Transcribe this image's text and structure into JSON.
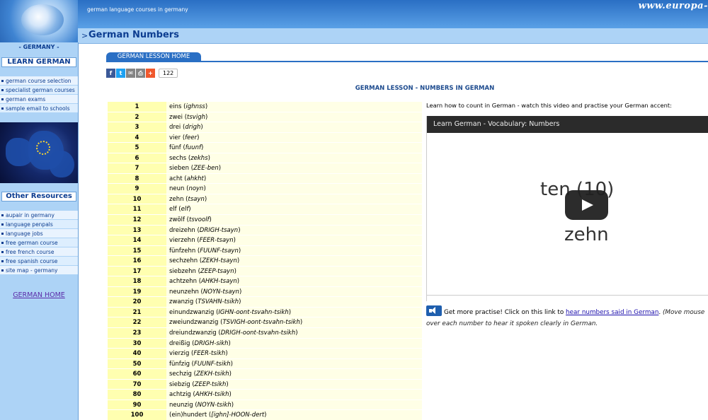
{
  "header": {
    "tagline": "german language courses in germany",
    "site_url": "www.europa-"
  },
  "title_bar": {
    "arrow": ">",
    "title": "German Numbers"
  },
  "sidebar": {
    "country": "- GERMANY -",
    "learn_heading": "LEARN GERMAN",
    "learn_items": [
      {
        "label": "german course selection"
      },
      {
        "label": "specialist german courses"
      },
      {
        "label": "german exams"
      },
      {
        "label": "sample email to schools"
      }
    ],
    "resources_heading": "Other Resources",
    "resource_items": [
      {
        "label": "aupair in germany"
      },
      {
        "label": "language penpals"
      },
      {
        "label": "language jobs"
      },
      {
        "label": "free german course"
      },
      {
        "label": "free french course"
      },
      {
        "label": "free spanish course"
      },
      {
        "label": "site map - germany"
      }
    ],
    "home_link": "GERMAN HOME"
  },
  "lesson_tab": "GERMAN LESSON HOME",
  "share": {
    "buttons": [
      {
        "icon": "facebook-icon",
        "glyph": "f",
        "color": "#3b5998"
      },
      {
        "icon": "twitter-icon",
        "glyph": "t",
        "color": "#1da1f2"
      },
      {
        "icon": "email-icon",
        "glyph": "✉",
        "color": "#848484"
      },
      {
        "icon": "print-icon",
        "glyph": "⎙",
        "color": "#848484"
      },
      {
        "icon": "add-more-icon",
        "glyph": "+",
        "color": "#f0582d"
      }
    ],
    "count": "122"
  },
  "lesson_heading": "GERMAN LESSON - NUMBERS IN GERMAN",
  "numbers": [
    {
      "num": "1",
      "word": "eins",
      "pron": "ighnss"
    },
    {
      "num": "2",
      "word": "zwei",
      "pron": "tsvigh"
    },
    {
      "num": "3",
      "word": "drei",
      "pron": "drigh"
    },
    {
      "num": "4",
      "word": "vier",
      "pron": "feer"
    },
    {
      "num": "5",
      "word": "fünf",
      "pron": "fuunf"
    },
    {
      "num": "6",
      "word": "sechs",
      "pron": "zekhs"
    },
    {
      "num": "7",
      "word": "sieben",
      "pron": "ZEE-ben"
    },
    {
      "num": "8",
      "word": "acht",
      "pron": "ahkht"
    },
    {
      "num": "9",
      "word": "neun",
      "pron": "noyn"
    },
    {
      "num": "10",
      "word": "zehn",
      "pron": "tsayn"
    },
    {
      "num": "11",
      "word": "elf",
      "pron": "elf"
    },
    {
      "num": "12",
      "word": "zwölf",
      "pron": "tsvoolf"
    },
    {
      "num": "13",
      "word": "dreizehn",
      "pron": "DRIGH-tsayn"
    },
    {
      "num": "14",
      "word": "vierzehn",
      "pron": "FEER-tsayn"
    },
    {
      "num": "15",
      "word": "fünfzehn",
      "pron": "FUUNF-tsayn"
    },
    {
      "num": "16",
      "word": "sechzehn",
      "pron": "ZEKH-tsayn"
    },
    {
      "num": "17",
      "word": "siebzehn",
      "pron": "ZEEP-tsayn"
    },
    {
      "num": "18",
      "word": "achtzehn",
      "pron": "AHKH-tsayn"
    },
    {
      "num": "19",
      "word": "neunzehn",
      "pron": "NOYN-tsayn"
    },
    {
      "num": "20",
      "word": "zwanzig",
      "pron": "TSVAHN-tsikh"
    },
    {
      "num": "21",
      "word": "einundzwanzig",
      "pron": "IGHN-oont-tsvahn-tsikh"
    },
    {
      "num": "22",
      "word": "zweiundzwanzig",
      "pron": "TSVIGH-oont-tsvahn-tsikh"
    },
    {
      "num": "23",
      "word": "dreiundzwanzig",
      "pron": "DRIGH-oont-tsvahn-tsikh"
    },
    {
      "num": "30",
      "word": "dreißig",
      "pron": "DRIGH-sikh"
    },
    {
      "num": "40",
      "word": "vierzig",
      "pron": "FEER-tsikh"
    },
    {
      "num": "50",
      "word": "fünfzig",
      "pron": "FUUNF-tsikh"
    },
    {
      "num": "60",
      "word": "sechzig",
      "pron": "ZEKH-tsikh"
    },
    {
      "num": "70",
      "word": "siebzig",
      "pron": "ZEEP-tsikh"
    },
    {
      "num": "80",
      "word": "achtzig",
      "pron": "AHKH-tsikh"
    },
    {
      "num": "90",
      "word": "neunzig",
      "pron": "NOYN-tsikh"
    },
    {
      "num": "100",
      "word": "(ein)hundert",
      "pron": "[ighn]-HOON-dert"
    }
  ],
  "intro_text": "Learn how to count in German - watch this video and practise your German accent:",
  "video": {
    "title": "Learn German - Vocabulary: Numbers",
    "frame_line1": "ten (10)",
    "frame_line2": "zehn"
  },
  "practise": {
    "text_before": "Get more practise! Click on this link to ",
    "link": "hear numbers said in German",
    "text_after": ".",
    "note": "(Move mouse over each number to hear it spoken clearly in German."
  }
}
